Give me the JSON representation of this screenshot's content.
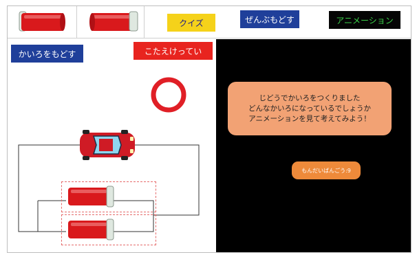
{
  "toolbar": {
    "quiz_label": "クイズ",
    "parts_label": "ぜんぶもどす",
    "animation_label": "アニメーション"
  },
  "left_panel": {
    "reset_circuit_label": "かいろをもどす",
    "answer_label": "こたえけってい"
  },
  "right_panel": {
    "message_lines": [
      "じどうでかいろをつくりました",
      "どんなかいろになっているでしょうか",
      "アニメーションを見て考えてみよう！"
    ],
    "problem_number_label": "もんだいばんごう:9"
  },
  "colors": {
    "battery_red": "#d9191c",
    "car_red": "#cf1b25",
    "answer_circle": "#e01f26",
    "quiz_yellow": "#f5d21a",
    "button_blue": "#1f3f9a",
    "animation_green": "#3bd24a",
    "bubble_orange": "#f2a274",
    "problem_orange": "#ee8a3a"
  },
  "icons": [
    "battery-icon",
    "car-icon",
    "answer-circle-icon"
  ]
}
